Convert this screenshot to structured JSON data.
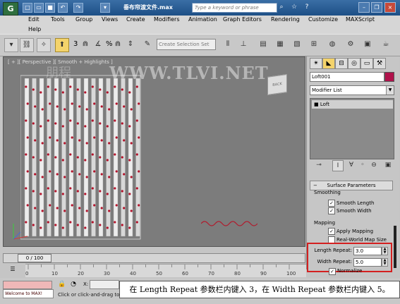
{
  "titlebar": {
    "app_logo": "G",
    "window_title": "垂布帘渡文件.max",
    "search_placeholder": "Type a keyword or phrase",
    "quick_icons": [
      "new-file-icon",
      "open-folder-icon",
      "save-icon",
      "undo-icon",
      "redo-icon"
    ],
    "window_buttons": [
      "minimize-icon",
      "restore-icon",
      "close-icon"
    ]
  },
  "menubar": {
    "items": [
      "Edit",
      "Tools",
      "Group",
      "Views",
      "Create",
      "Modifiers",
      "Animation",
      "Graph Editors",
      "Rendering",
      "Customize",
      "MAXScript"
    ],
    "second_row": [
      "Help"
    ]
  },
  "toolbar": {
    "selection_set_placeholder": "Create Selection Set",
    "snap_labels": [
      "3",
      "%",
      "n"
    ]
  },
  "viewport": {
    "label": "[ + ][ Perspective ][ Smooth + Highlights ]",
    "watermark": "WWW.TLVI.NET",
    "watermark_cn": "朋程",
    "viewcube_label": "BACK"
  },
  "command_panel": {
    "object_name": "Loft001",
    "object_color": "#b0124b",
    "modifier_list": "Modifier List",
    "stack_items": [
      "Loft"
    ],
    "rollout_title": "Surface Parameters",
    "smoothing_label": "Smoothing",
    "smooth_length_label": "Smooth Length",
    "smooth_length_checked": true,
    "smooth_width_label": "Smooth Width",
    "smooth_width_checked": true,
    "mapping_label": "Mapping",
    "apply_mapping_label": "Apply Mapping",
    "apply_mapping_checked": true,
    "real_world_label": "Real-World Map Size",
    "real_world_checked": false,
    "length_repeat_label": "Length Repeat:",
    "length_repeat_value": "3.0",
    "width_repeat_label": "Width Repeat:",
    "width_repeat_value": "5.0",
    "normalize_label": "Normalize"
  },
  "timeline": {
    "slider_label": "0 / 100",
    "ticks": [
      "0",
      "10",
      "20",
      "30",
      "40",
      "50",
      "60",
      "70",
      "80",
      "90",
      "100"
    ]
  },
  "status": {
    "welcome_text": "Welcome to MAX!",
    "x_label": "X:",
    "prompt": "Click or click-and-drag to"
  },
  "caption": "在 Length Repeat 参数栏内键入 3，在 Width Repeat 参数栏内键入 5。"
}
